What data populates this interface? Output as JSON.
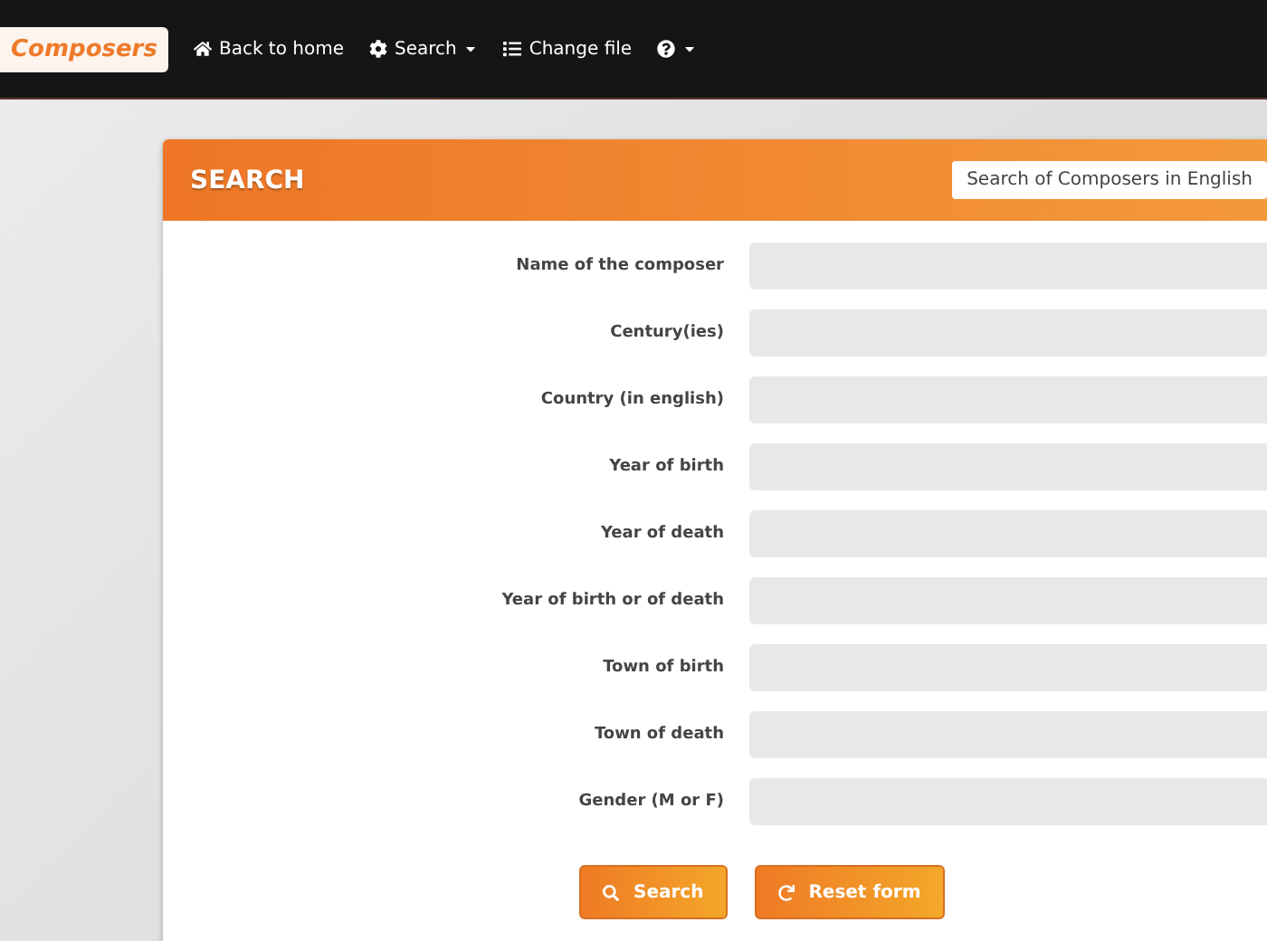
{
  "navbar": {
    "brand": "Composers",
    "items": [
      {
        "kind": "home",
        "label": "Back to home",
        "dropdown": false
      },
      {
        "kind": "settings",
        "label": "Search",
        "dropdown": true
      },
      {
        "kind": "file",
        "label": "Change file",
        "dropdown": false
      },
      {
        "kind": "help",
        "dropdown": true
      }
    ]
  },
  "panel": {
    "title": "SEARCH",
    "selector": "Search of Composers in English",
    "fields": [
      {
        "label": "Name of the composer"
      },
      {
        "label": "Century(ies)"
      },
      {
        "label": "Country (in english)"
      },
      {
        "label": "Year of birth"
      },
      {
        "label": "Year of death"
      },
      {
        "label": "Year of birth or of death"
      },
      {
        "label": "Town of birth"
      },
      {
        "label": "Town of death"
      },
      {
        "label": "Gender (M or F)"
      }
    ],
    "buttons": [
      {
        "kind": "search",
        "label": "Search"
      },
      {
        "kind": "reset",
        "label": "Reset form"
      }
    ]
  }
}
